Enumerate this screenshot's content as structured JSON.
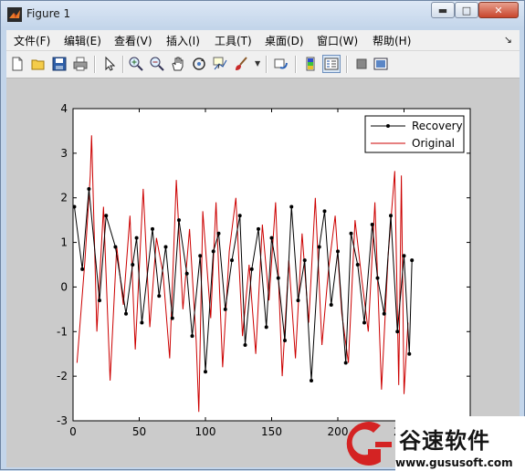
{
  "window": {
    "title": "Figure 1"
  },
  "window_controls": {
    "minimize": "▬",
    "maximize": "□",
    "close": "✕"
  },
  "menu": [
    "文件(F)",
    "编辑(E)",
    "查看(V)",
    "插入(I)",
    "工具(T)",
    "桌面(D)",
    "窗口(W)",
    "帮助(H)"
  ],
  "menu_overflow": "↘",
  "toolbar": [
    "new-figure-icon",
    "open-file-icon",
    "save-icon",
    "print-icon",
    "select-arrow-icon",
    "zoom-in-icon",
    "zoom-out-icon",
    "pan-hand-icon",
    "rotate-3d-icon",
    "data-cursor-icon",
    "brush-icon",
    "link-plot-icon",
    "colorbar-icon",
    "legend-icon",
    "hide-plot-tools-icon",
    "show-plot-tools-icon"
  ],
  "chart_data": {
    "type": "line",
    "title": "",
    "xlabel": "",
    "ylabel": "",
    "xlim": [
      0,
      300
    ],
    "ylim": [
      -3,
      4
    ],
    "xticks": [
      "0",
      "50",
      "100",
      "150",
      "200",
      "250",
      "300"
    ],
    "yticks": [
      "-3",
      "-2",
      "-1",
      "0",
      "1",
      "2",
      "3",
      "4"
    ],
    "grid": false,
    "legend": "top-right",
    "series": [
      {
        "name": "Recovery",
        "color": "#000000",
        "marker": "dot",
        "x": [
          1,
          7,
          12,
          20,
          25,
          32,
          40,
          45,
          48,
          52,
          60,
          65,
          70,
          75,
          80,
          86,
          90,
          96,
          100,
          106,
          110,
          115,
          120,
          126,
          130,
          135,
          140,
          146,
          150,
          155,
          160,
          165,
          170,
          175,
          180,
          186,
          190,
          195,
          200,
          206,
          210,
          215,
          220,
          226,
          230,
          235,
          240,
          245,
          250,
          254,
          256
        ],
        "values": [
          1.8,
          0.4,
          2.2,
          -0.3,
          1.6,
          0.9,
          -0.6,
          0.5,
          1.1,
          -0.8,
          1.3,
          -0.2,
          0.9,
          -0.7,
          1.5,
          0.3,
          -1.1,
          0.7,
          -1.9,
          0.8,
          1.2,
          -0.5,
          0.6,
          1.6,
          -1.3,
          0.4,
          1.3,
          -0.9,
          1.1,
          0.2,
          -1.2,
          1.8,
          -0.3,
          0.6,
          -2.1,
          0.9,
          1.7,
          -0.4,
          0.8,
          -1.7,
          1.2,
          0.5,
          -0.8,
          1.4,
          0.2,
          -0.6,
          1.6,
          -1.0,
          0.7,
          -1.5,
          0.6
        ]
      },
      {
        "name": "Original",
        "color": "#cc0000",
        "marker": "none",
        "x": [
          3,
          9,
          13,
          14,
          18,
          23,
          28,
          33,
          38,
          43,
          47,
          53,
          58,
          63,
          68,
          73,
          78,
          83,
          88,
          93,
          95,
          98,
          104,
          108,
          113,
          118,
          123,
          128,
          133,
          138,
          143,
          148,
          153,
          158,
          163,
          168,
          173,
          178,
          183,
          188,
          193,
          198,
          203,
          208,
          213,
          218,
          223,
          228,
          233,
          238,
          243,
          246,
          248,
          250,
          253
        ],
        "values": [
          -1.7,
          0.6,
          2.5,
          3.4,
          -1.0,
          1.8,
          -2.1,
          0.9,
          -0.4,
          1.6,
          -1.4,
          2.2,
          -0.9,
          1.1,
          0.3,
          -1.6,
          2.4,
          -0.5,
          1.3,
          -1.2,
          -2.8,
          1.7,
          -0.7,
          1.9,
          -1.8,
          0.8,
          2.0,
          -1.1,
          0.5,
          -1.5,
          1.4,
          -0.3,
          1.9,
          -2.0,
          0.6,
          -1.6,
          1.2,
          -0.8,
          2.0,
          -1.3,
          0.4,
          1.6,
          -0.6,
          -1.7,
          1.5,
          0.2,
          -1.0,
          1.9,
          -2.3,
          0.7,
          2.6,
          -2.2,
          2.5,
          -2.4,
          -0.8
        ]
      }
    ]
  },
  "watermark": {
    "brand": "谷速软件",
    "url": "www.gususoft.com"
  }
}
